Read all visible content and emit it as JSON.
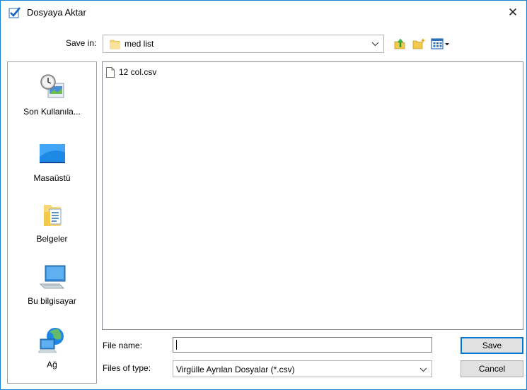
{
  "window": {
    "title": "Dosyaya Aktar",
    "close_glyph": "✕"
  },
  "toolbar": {
    "save_in_label": "Save in:",
    "save_in_value": "med list",
    "icons": [
      "up-folder-icon",
      "new-folder-icon",
      "view-menu-icon"
    ]
  },
  "places": [
    {
      "label": "Son Kullanıla...",
      "icon": "recent-places-icon"
    },
    {
      "label": "Masaüstü",
      "icon": "desktop-icon"
    },
    {
      "label": "Belgeler",
      "icon": "documents-icon"
    },
    {
      "label": "Bu bilgisayar",
      "icon": "computer-icon"
    },
    {
      "label": "Ağ",
      "icon": "network-icon"
    }
  ],
  "files": [
    {
      "name": "12 col.csv",
      "icon": "file-icon"
    }
  ],
  "bottom": {
    "file_name_label": "File name:",
    "file_name_value": "",
    "files_of_type_label": "Files of type:",
    "files_of_type_value": "Virgülle Ayrılan Dosyalar (*.csv)"
  },
  "buttons": {
    "save": "Save",
    "cancel": "Cancel"
  },
  "colors": {
    "accent": "#0078d7",
    "window_border": "#1883d7",
    "folder": "#f8d775"
  }
}
